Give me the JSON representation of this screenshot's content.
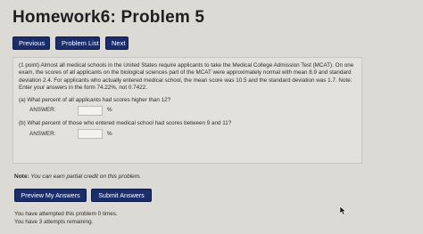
{
  "header": {
    "title": "Homework6: Problem 5"
  },
  "nav": {
    "previous": "Previous",
    "problem_list": "Problem List",
    "next": "Next"
  },
  "problem": {
    "intro": "(1 point) Almost all medical schools in the United States require applicants to take the Medical College Admission Test (MCAT). On one exam, the scores of all applicants on the biological sciences part of the MCAT were approximately normal with mean 8.9 and standard deviation 2.4. For applicants who actually entered medical school, the mean score was 10.5 and the standard deviation was 1.7. Note: Enter your answers in the form 74.22%, not 0.7422.",
    "part_a": {
      "question": "(a) What percent of all applicants had scores higher than 12?",
      "answer_label": "ANSWER:",
      "answer_value": "",
      "unit": "%"
    },
    "part_b": {
      "question": "(b) What percent of those who entered medical school had scores between 9 and 11?",
      "answer_label": "ANSWER:",
      "answer_value": "",
      "unit": "%"
    }
  },
  "note": {
    "label": "Note:",
    "text": "You can earn partial credit on this problem."
  },
  "actions": {
    "preview": "Preview My Answers",
    "submit": "Submit Answers"
  },
  "status": {
    "attempted": "You have attempted this problem 0 times.",
    "remaining": "You have 3 attempts remaining."
  },
  "colors": {
    "button_bg": "#1c2d6b",
    "page_bg": "#dcdad5",
    "box_bg": "#e3e1dc"
  }
}
